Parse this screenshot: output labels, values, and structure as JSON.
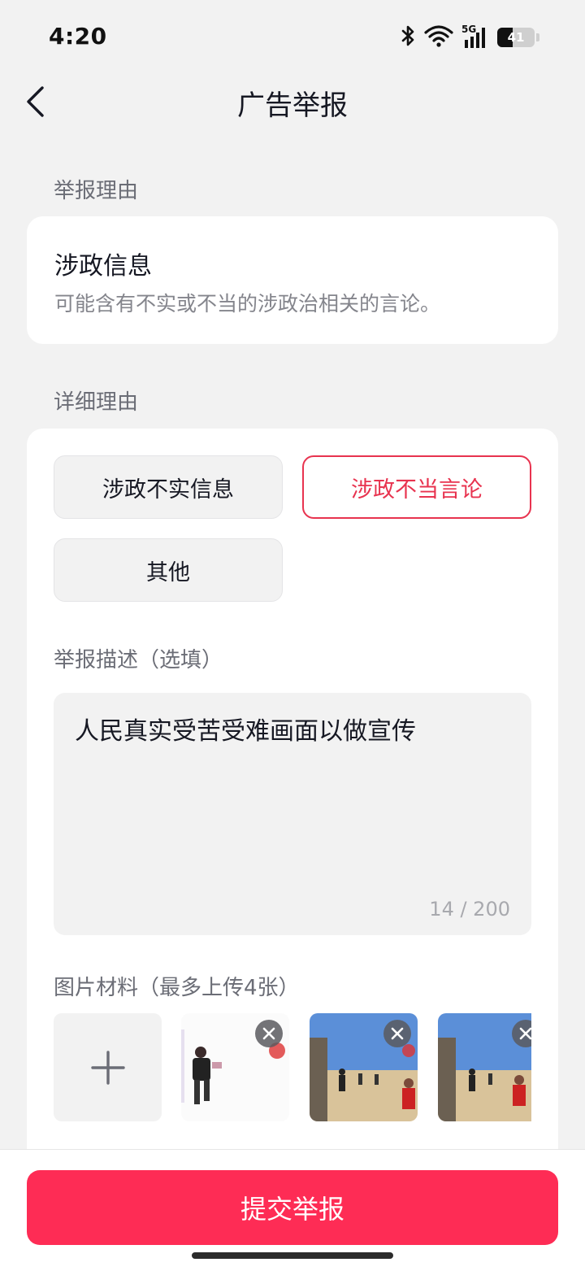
{
  "status_bar": {
    "time": "4:20",
    "network": "5G",
    "battery": "41",
    "battery_level": 0.41
  },
  "header": {
    "title": "广告举报"
  },
  "reason_section": {
    "label": "举报理由",
    "title": "涉政信息",
    "description": "可能含有不实或不当的涉政治相关的言论。"
  },
  "detail_section": {
    "label": "详细理由",
    "options": [
      {
        "label": "涉政不实信息",
        "selected": false
      },
      {
        "label": "涉政不当言论",
        "selected": true
      },
      {
        "label": "其他",
        "selected": false
      }
    ],
    "description_label": "举报描述（选填）",
    "description_value": "人民真实受苦受难画面以做宣传",
    "char_count": "14 / 200",
    "images_label": "图片材料（最多上传4张）",
    "images": [
      {
        "icon": "photo-thumbnail"
      },
      {
        "icon": "photo-thumbnail"
      },
      {
        "icon": "photo-thumbnail"
      }
    ]
  },
  "footer": {
    "submit_label": "提交举报"
  },
  "colors": {
    "accent": "#fe2c55",
    "selected_border": "#e8334f",
    "background": "#f2f2f2"
  }
}
